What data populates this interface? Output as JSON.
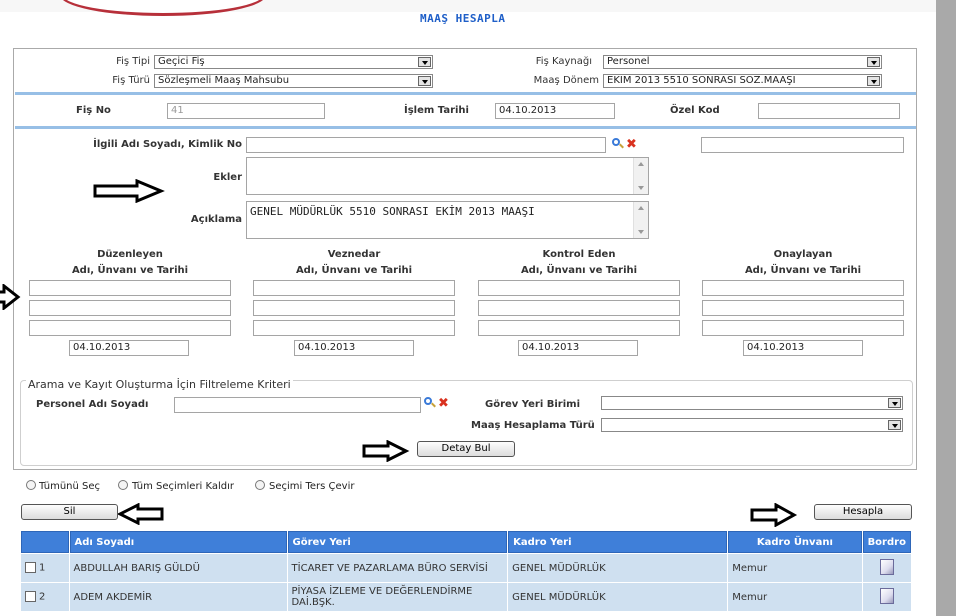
{
  "page": {
    "title": "MAAŞ HESAPLA"
  },
  "header": {
    "fis_tipi_label": "Fiş Tipi",
    "fis_tipi_value": "Geçici Fiş",
    "fis_turu_label": "Fiş Türü",
    "fis_turu_value": "Sözleşmeli Maaş Mahsubu",
    "fis_kaynagi_label": "Fiş Kaynağı",
    "fis_kaynagi_value": "Personel",
    "maas_donem_label": "Maaş Dönem",
    "maas_donem_value": "EKİM 2013 5510 SONRASI SÖZ.MAAŞI"
  },
  "info": {
    "fis_no_label": "Fiş No",
    "fis_no_value": "41",
    "islem_tarihi_label": "İşlem Tarihi",
    "islem_tarihi_value": "04.10.2013",
    "ozel_kod_label": "Özel Kod",
    "ozel_kod_value": ""
  },
  "details": {
    "ilgili_label": "İlgili Adı Soyadı, Kimlik No",
    "ilgili_value": "",
    "ekler_label": "Ekler",
    "ekler_value": "",
    "aciklama_label": "Açıklama",
    "aciklama_value": "GENEL MÜDÜRLÜK 5510 SONRASI EKİM 2013 MAAŞI"
  },
  "signers": [
    {
      "title": "Düzenleyen",
      "subtitle": "Adı, Ünvanı ve Tarihi",
      "date": "04.10.2013"
    },
    {
      "title": "Veznedar",
      "subtitle": "Adı, Ünvanı ve Tarihi",
      "date": "04.10.2013"
    },
    {
      "title": "Kontrol Eden",
      "subtitle": "Adı, Ünvanı ve Tarihi",
      "date": "04.10.2013"
    },
    {
      "title": "Onaylayan",
      "subtitle": "Adı, Ünvanı ve Tarihi",
      "date": "04.10.2013"
    }
  ],
  "filter": {
    "legend": "Arama ve Kayıt Oluşturma İçin Filtreleme Kriteri",
    "personel_label": "Personel Adı Soyadı",
    "personel_value": "",
    "gorev_label": "Görev Yeri Birimi",
    "gorev_value": "",
    "hesaplama_label": "Maaş Hesaplama Türü",
    "hesaplama_value": "",
    "detay_button": "Detay Bul"
  },
  "selection": {
    "select_all": "Tümünü Seç",
    "clear_all": "Tüm Seçimleri Kaldır",
    "invert": "Seçimi Ters Çevir"
  },
  "actions": {
    "delete_button": "Sil",
    "calculate_button": "Hesapla"
  },
  "table": {
    "columns": [
      "Adı Soyadı",
      "Görev Yeri",
      "Kadro Yeri",
      "Kadro Ünvanı",
      "Bordro"
    ],
    "rows": [
      {
        "no": "1",
        "name": "ABDULLAH BARIŞ GÜLDÜ",
        "gorev": "TİCARET VE PAZARLAMA BÜRO SERVİSİ",
        "kadro": "GENEL MÜDÜRLÜK",
        "unvan": "Memur"
      },
      {
        "no": "2",
        "name": "ADEM AKDEMİR",
        "gorev": "PİYASA İZLEME VE DEĞERLENDİRME DAİ.BŞK.",
        "kadro": "GENEL MÜDÜRLÜK",
        "unvan": "Memur"
      }
    ]
  }
}
